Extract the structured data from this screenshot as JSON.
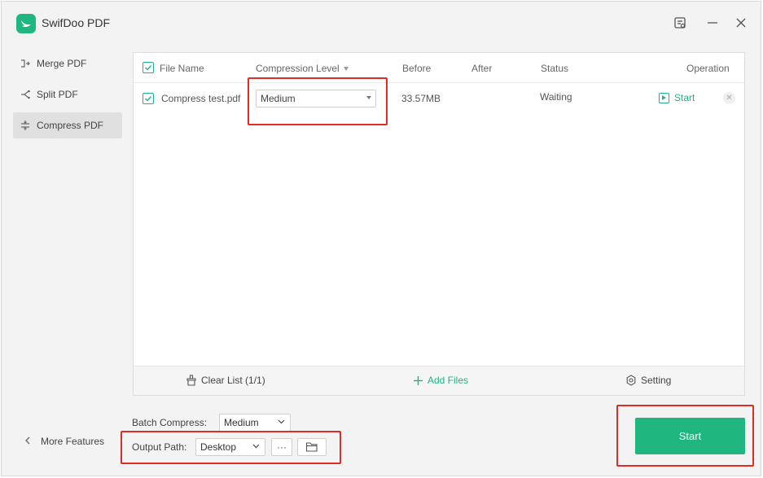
{
  "app": {
    "title": "SwifDoo PDF"
  },
  "window_controls": [
    {
      "name": "feedback-icon",
      "glyph": "⊡"
    },
    {
      "name": "minimize-icon",
      "glyph": "—"
    },
    {
      "name": "close-icon",
      "glyph": "✕"
    }
  ],
  "sidebar": {
    "items": [
      {
        "label": "Merge PDF",
        "icon": "merge-icon",
        "active": false
      },
      {
        "label": "Split PDF",
        "icon": "split-icon",
        "active": false
      },
      {
        "label": "Compress PDF",
        "icon": "compress-icon",
        "active": true
      }
    ],
    "more_label": "More Features"
  },
  "table": {
    "headers": {
      "file_name": "File Name",
      "compression_level": "Compression Level",
      "before": "Before",
      "after": "After",
      "status": "Status",
      "operation": "Operation"
    },
    "rows": [
      {
        "file_name": "Compress test.pdf",
        "compression_level": "Medium",
        "before": "33.57MB",
        "after": "",
        "status": "Waiting",
        "operation": "Start"
      }
    ]
  },
  "panel_footer": {
    "clear_list": "Clear List (1/1)",
    "add_files": "Add Files",
    "setting": "Setting"
  },
  "bottom": {
    "batch_compress_label": "Batch Compress:",
    "batch_compress_value": "Medium",
    "output_path_label": "Output Path:",
    "output_path_value": "Desktop",
    "more_button": "···"
  },
  "start_button": "Start",
  "colors": {
    "accent": "#1fb67f",
    "highlight": "#e02b27"
  }
}
